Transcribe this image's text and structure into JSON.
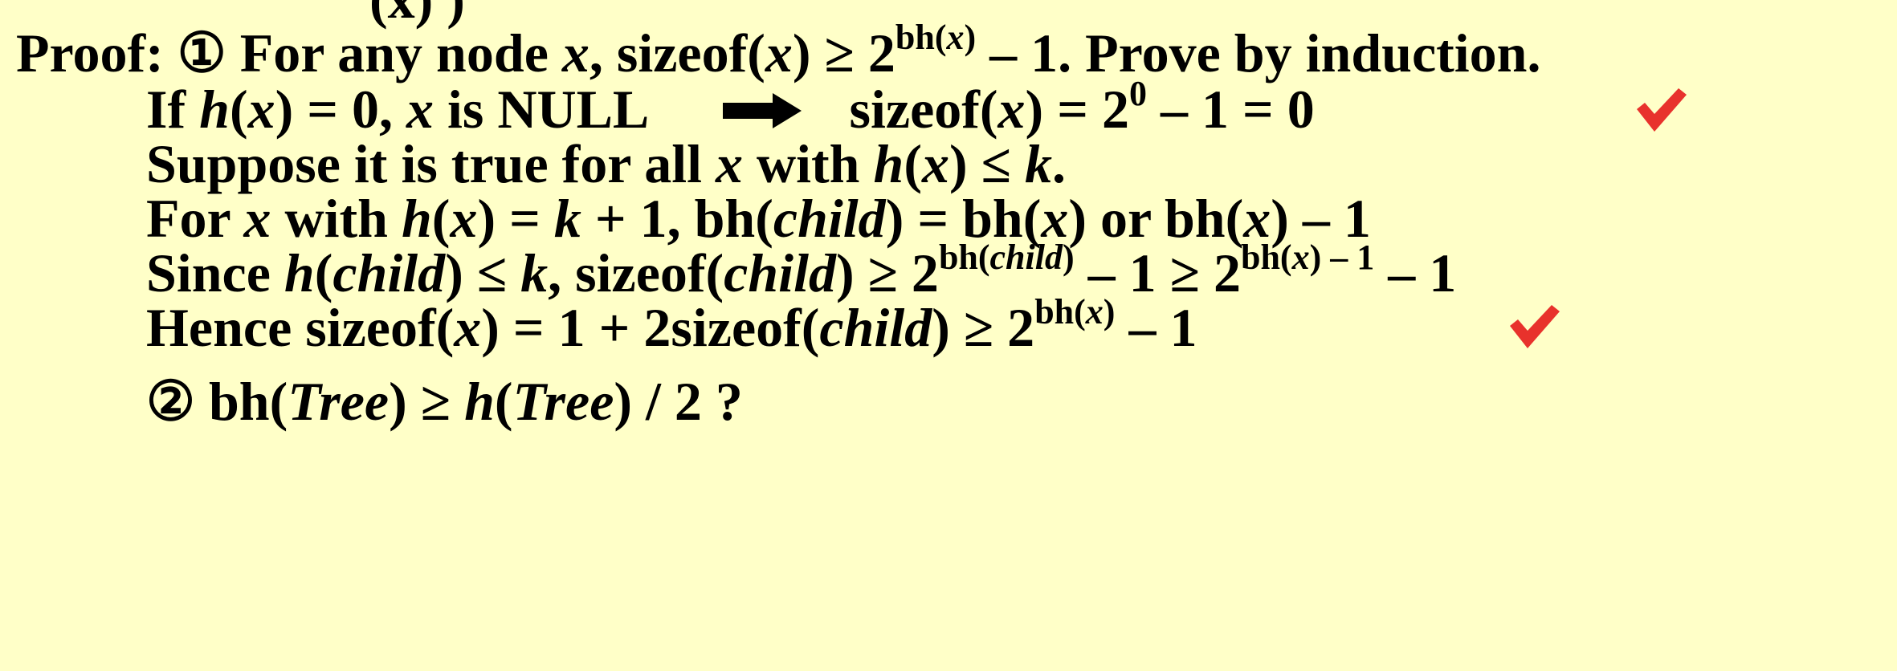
{
  "top_fragment": "(x) )",
  "l1": {
    "proof_label": "Proof:",
    "num": "①",
    "a": "For any node",
    "x": "x",
    "b": ", sizeof(",
    "c": ") ≥ 2",
    "sup_a": "bh(",
    "sup_b": ")",
    "d": "– 1.  Prove by induction."
  },
  "l2": {
    "a": "If ",
    "h": "h",
    "b": "(",
    "x": "x",
    "c": ") = 0, ",
    "d": " is NULL",
    "e": "sizeof(",
    "f": ") = 2",
    "sup": "0",
    "g": " – 1 = 0"
  },
  "l3": {
    "a": "Suppose it is true for all ",
    "b": " with ",
    "c": "(",
    "d": ") ≤ ",
    "k": "k",
    "e": "."
  },
  "l4": {
    "a": "For ",
    "b": " with ",
    "c": "(",
    "d": ") = ",
    "e": " + 1, bh(",
    "child": "child",
    "f": ") =  bh(",
    "g": ") or bh(",
    "h2": ") – 1"
  },
  "l5": {
    "a": "Since ",
    "b": "(",
    "c": ") ≤ ",
    "d": ", sizeof(",
    "e": ") ≥ 2",
    "sup1a": "bh(",
    "sup1b": ")",
    "f": " – 1  ≥ 2",
    "sup2a": "bh(",
    "sup2b": ") – 1",
    "g": " – 1"
  },
  "l6": {
    "a": "Hence sizeof(",
    "b": ") = 1 + 2sizeof(",
    "c": ") ≥ 2",
    "supa": "bh(",
    "supb": ")",
    "d": " – 1"
  },
  "l7": {
    "num": "②",
    "a": " bh(",
    "tree": "Tree",
    "b": ") ≥ ",
    "c": "(",
    "d": ") / 2  ?"
  },
  "colors": {
    "background": "#FFFFC8",
    "check": "#E8322C"
  }
}
